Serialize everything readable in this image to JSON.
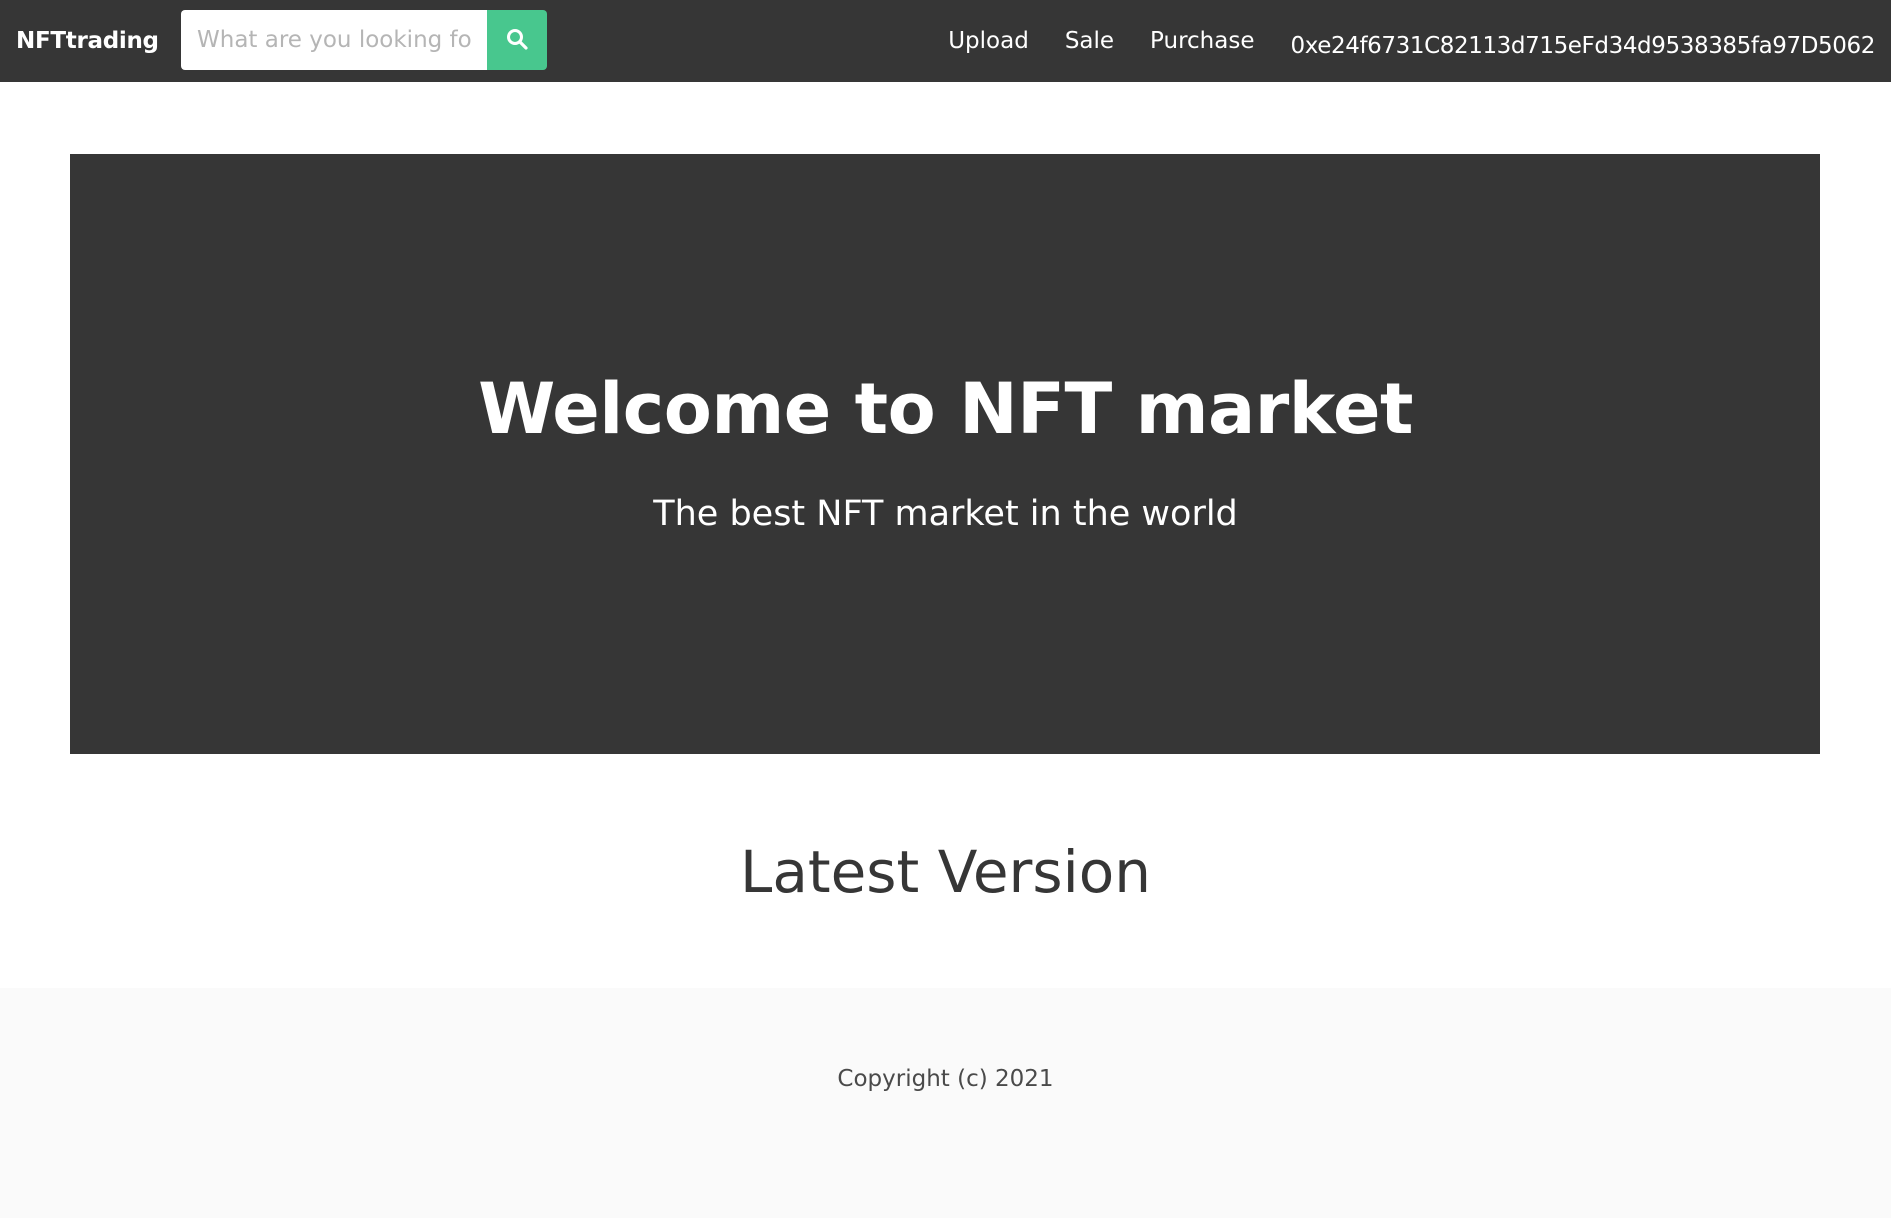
{
  "navbar": {
    "brand": "NFTtrading",
    "search": {
      "placeholder": "What are you looking for?",
      "value": "",
      "button_icon": "search-icon"
    },
    "links": {
      "upload": "Upload",
      "sale": "Sale",
      "purchase": "Purchase"
    },
    "wallet_address": "0xe24f6731C82113d715eFd34d9538385fa97D5062"
  },
  "hero": {
    "title": "Welcome to NFT market",
    "subtitle": "The best NFT market in the world"
  },
  "main": {
    "section_title": "Latest Version"
  },
  "footer": {
    "copyright": "Copyright (c) 2021"
  },
  "colors": {
    "navbar_bg": "#363636",
    "hero_bg": "#363636",
    "search_button": "#48c78e",
    "footer_bg": "#fafafa",
    "text_dark": "#363636"
  }
}
